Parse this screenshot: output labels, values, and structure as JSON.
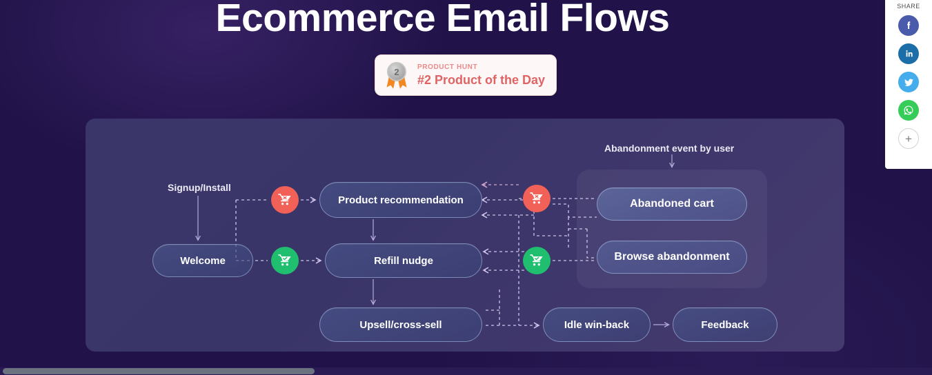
{
  "page": {
    "title": "Ecommerce Email Flows",
    "background_color": "#211349"
  },
  "product_hunt_badge": {
    "medal_rank": "2",
    "kicker": "PRODUCT HUNT",
    "headline": "#2 Product of the Day",
    "kicker_color": "#eb8a8a",
    "headline_color": "#e06464",
    "card_background": "#fdf7f7"
  },
  "share_rail": {
    "label": "SHARE",
    "buttons": [
      {
        "name": "facebook",
        "glyph": "f",
        "color": "#4a5bab"
      },
      {
        "name": "linkedin",
        "glyph": "in",
        "color": "#1b6ea8"
      },
      {
        "name": "twitter",
        "glyph": "bird",
        "color": "#46adec"
      },
      {
        "name": "whatsapp",
        "glyph": "phone",
        "color": "#35cc58"
      },
      {
        "name": "more",
        "glyph": "+",
        "color": "#ffffff"
      }
    ]
  },
  "diagram": {
    "container_gradient_from": "#3b3669",
    "container_gradient_to": "#453a6e",
    "labels": {
      "signup": "Signup/Install",
      "abandonment_event": "Abandonment event by user"
    },
    "nodes": {
      "welcome": "Welcome",
      "product_recommendation": "Product recommendation",
      "refill_nudge": "Refill nudge",
      "upsell_cross_sell": "Upsell/cross-sell",
      "idle_win_back": "Idle win-back",
      "feedback": "Feedback",
      "abandoned_cart": "Abandoned cart",
      "browse_abandonment": "Browse abandonment"
    },
    "cart_badges": [
      {
        "id": "cart-abandoned-top",
        "type": "abandoned-cart-icon",
        "color": "#f26157"
      },
      {
        "id": "cart-success-left",
        "type": "completed-cart-icon",
        "color": "#1fbf6f"
      },
      {
        "id": "cart-abandoned-mid",
        "type": "abandoned-cart-icon",
        "color": "#f26157"
      },
      {
        "id": "cart-success-mid",
        "type": "completed-cart-icon",
        "color": "#1fbf6f"
      }
    ]
  },
  "scrollbar": {
    "orientation": "horizontal",
    "thumb_color": "#6b7280"
  }
}
